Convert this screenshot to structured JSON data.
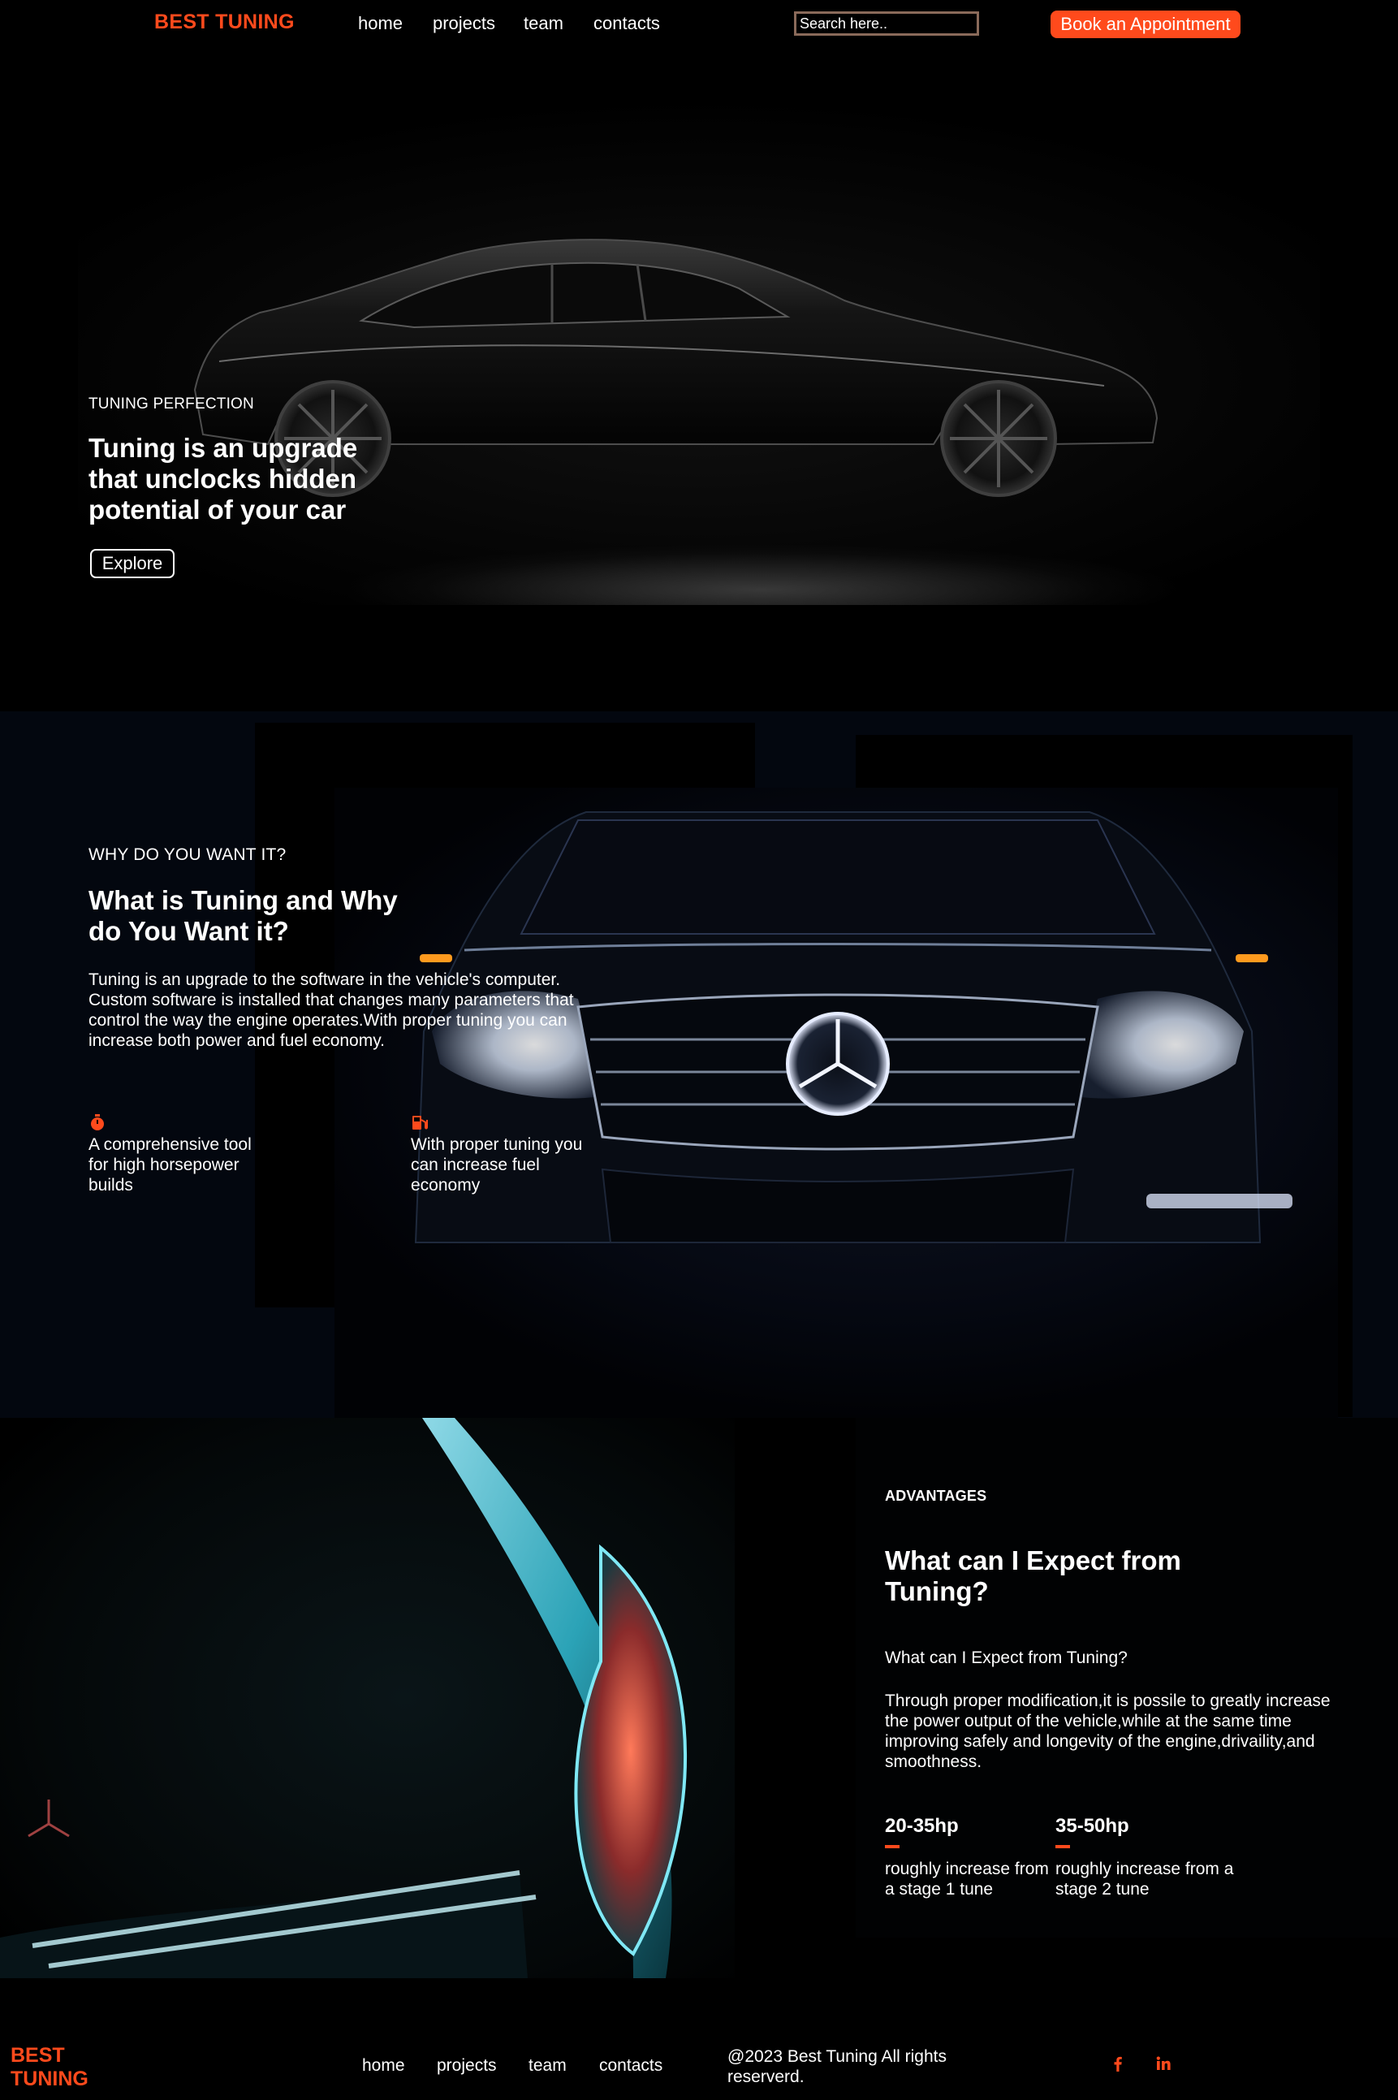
{
  "nav": {
    "brand": "BEST TUNING",
    "links": [
      "home",
      "projects",
      "team",
      "contacts"
    ],
    "search_placeholder": "Search here..",
    "cta": "Book an Appointment"
  },
  "hero": {
    "eyebrow": "TUNING PERFECTION",
    "title": "Tuning is an upgrade that unclocks hidden potential of your car",
    "button": "Explore"
  },
  "why": {
    "eyebrow": "WHY DO YOU WANT IT?",
    "title": "What is Tuning and Why do You Want it?",
    "description": "Tuning is an upgrade to the software in the vehicle's computer. Custom software is installed that changes many parameters that control the way the engine operates.With proper tuning you can increase both power and fuel economy.",
    "features": [
      {
        "icon": "stopwatch-icon",
        "text": "A comprehensive tool for high horsepower builds"
      },
      {
        "icon": "fuel-pump-icon",
        "text": "With proper tuning you can increase fuel economy"
      }
    ]
  },
  "advantages": {
    "eyebrow": "ADVANTAGES",
    "title": "What can I Expect from Tuning?",
    "subtitle": "What can I Expect from Tuning?",
    "body": "Through proper modification,it is possile to greatly increase the power output of the vehicle,while at the same time improving safely and longevity of the engine,drivaility,and smoothness.",
    "stats": [
      {
        "value": "20-35hp",
        "desc": "roughly increase from a stage 1 tune"
      },
      {
        "value": "35-50hp",
        "desc": "roughly increase from a stage 2 tune"
      }
    ]
  },
  "footer": {
    "brand": "BEST TUNING",
    "links": [
      "home",
      "projects",
      "team",
      "contacts"
    ],
    "copyright": "@2023 Best Tuning All rights reserverd.",
    "social": [
      "facebook-icon",
      "linkedin-icon"
    ]
  },
  "colors": {
    "accent": "#ff4a1c",
    "background": "#000000"
  }
}
